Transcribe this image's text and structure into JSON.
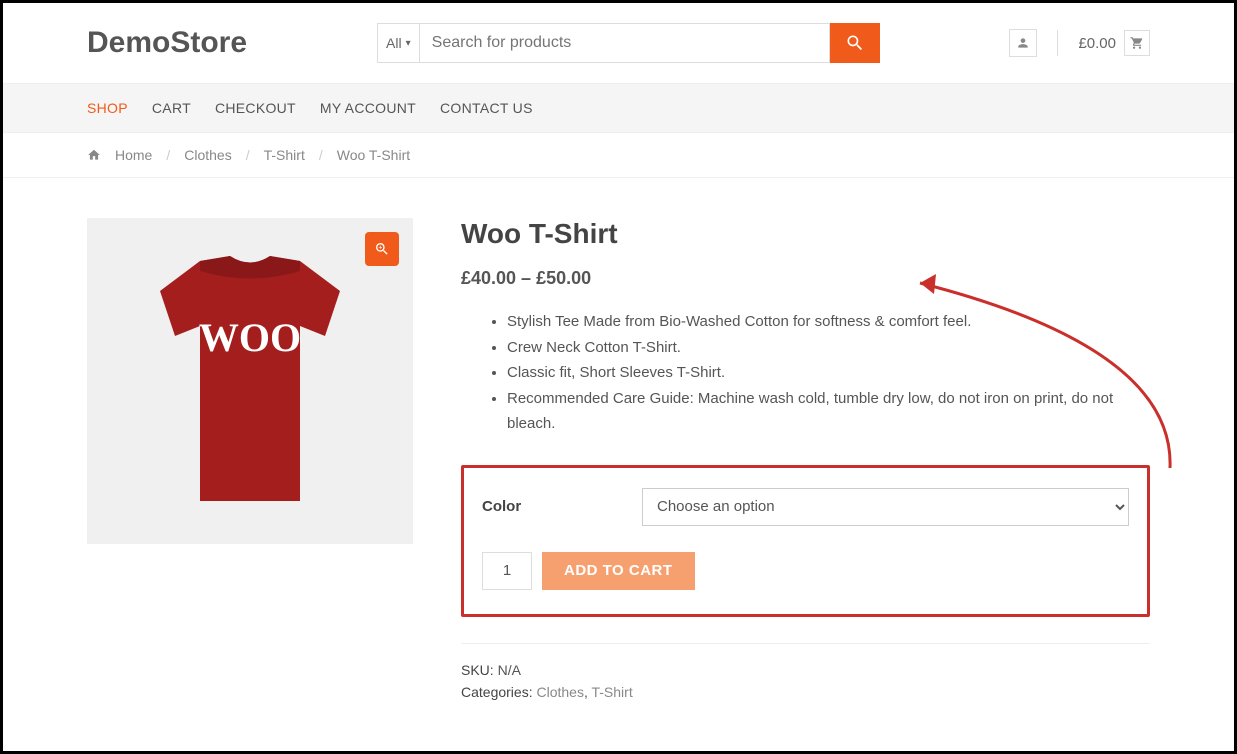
{
  "header": {
    "logo": "DemoStore",
    "category_select": "All",
    "search_placeholder": "Search for products",
    "cart_total": "£0.00"
  },
  "nav": {
    "items": [
      {
        "label": "SHOP",
        "active": true
      },
      {
        "label": "CART",
        "active": false
      },
      {
        "label": "CHECKOUT",
        "active": false
      },
      {
        "label": "MY ACCOUNT",
        "active": false
      },
      {
        "label": "CONTACT US",
        "active": false
      }
    ]
  },
  "breadcrumb": {
    "items": [
      "Home",
      "Clothes",
      "T-Shirt"
    ],
    "current": "Woo T-Shirt"
  },
  "product": {
    "title": "Woo T-Shirt",
    "price": "£40.00 – £50.00",
    "image_text": "WOO",
    "description": [
      "Stylish Tee Made from Bio-Washed Cotton for softness & comfort feel.",
      "Crew Neck Cotton T-Shirt.",
      "Classic fit, Short Sleeves T-Shirt.",
      "Recommended Care Guide: Machine wash cold, tumble dry low, do not iron on print, do not bleach."
    ],
    "variation": {
      "label": "Color",
      "selected": "Choose an option"
    },
    "quantity": "1",
    "add_to_cart_label": "ADD TO CART",
    "sku_label": "SKU:",
    "sku_value": "N/A",
    "categories_label": "Categories:",
    "categories": [
      "Clothes",
      "T-Shirt"
    ]
  },
  "colors": {
    "accent": "#f05a1a",
    "annotation": "#c9302c"
  }
}
